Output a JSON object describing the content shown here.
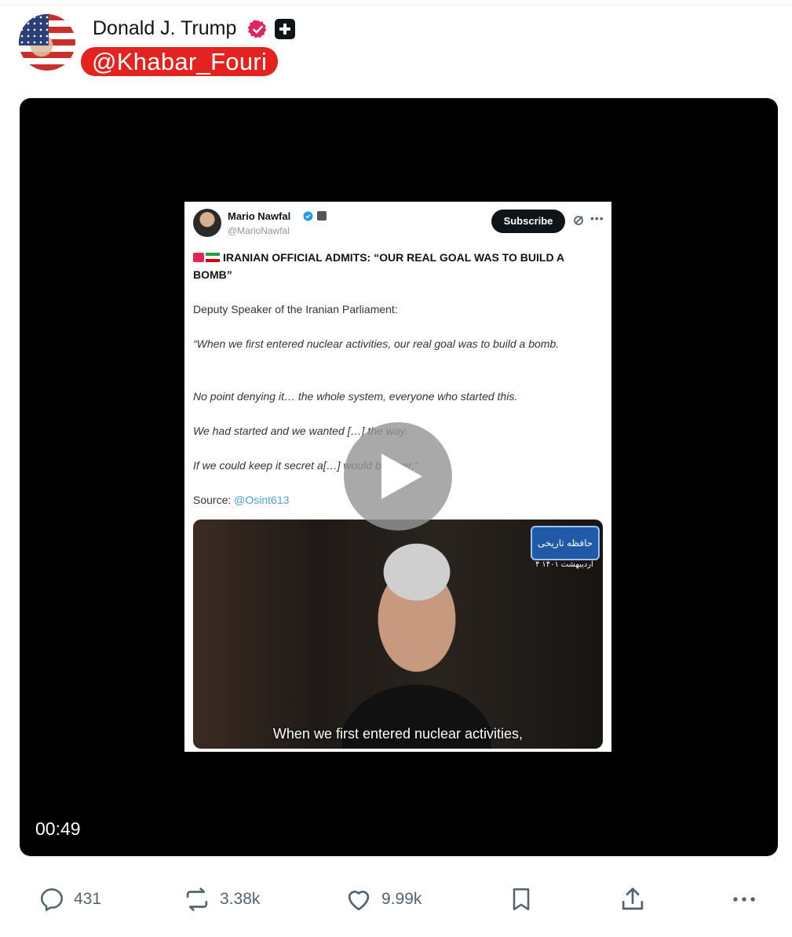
{
  "header": {
    "author_name": "Donald J. Trump",
    "watermark_handle": "@Khabar_Fouri",
    "icons": [
      "verified-badge-icon",
      "affiliate-badge-icon"
    ]
  },
  "video": {
    "timestamp": "00:49",
    "embedded_post": {
      "author_name": "Mario Nawfal",
      "author_handle": "@MarioNawfal",
      "subscribe_label": "Subscribe",
      "headline": "IRANIAN OFFICIAL ADMITS: “OUR REAL GOAL WAS TO BUILD A BOMB”",
      "paragraphs": [
        "Deputy Speaker of the Iranian Parliament:",
        "“When we first entered nuclear activities, our real goal was to build a bomb.",
        "No point denying it… the whole system, everyone who started this.",
        "We had started and we wanted […] the way.",
        "If we could keep it secret a[…] would be over.”"
      ],
      "source_label": "Source:",
      "source_handle": "@Osint613",
      "clip": {
        "channel_logo": "حافظه تاریخی",
        "channel_date": "۴ اردیبهشت ۱۴۰۱",
        "subtitle": "When we first entered nuclear activities,"
      }
    }
  },
  "actions": {
    "replies": "431",
    "reposts": "3.38k",
    "likes": "9.99k"
  },
  "colors": {
    "watermark_red": "#e4221f",
    "badge_pink": "#e0245e",
    "link_blue": "#4fa3d8",
    "icon_gray": "#536471"
  }
}
